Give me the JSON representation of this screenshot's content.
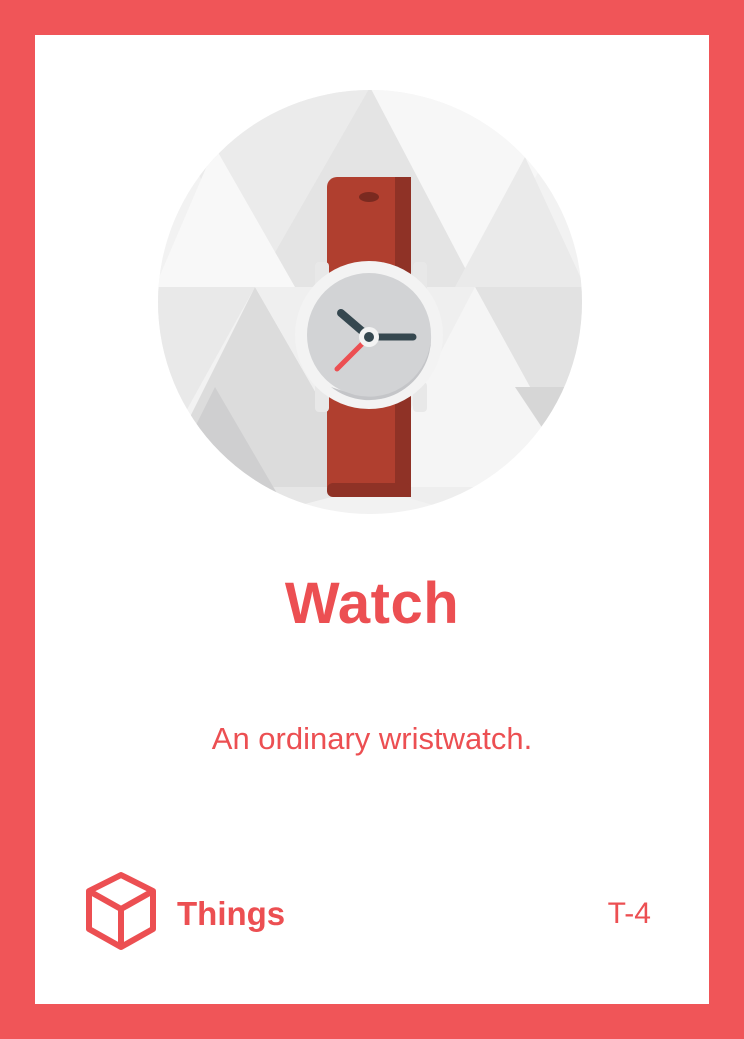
{
  "card": {
    "title": "Watch",
    "description": "An ordinary wristwatch.",
    "category": "Things",
    "code": "T-4"
  },
  "colors": {
    "frame": "#f05558",
    "accent": "#ec4f52",
    "strap": "#b03f2f",
    "strap_dark": "#8f3226",
    "case": "#f3f3f3",
    "dial": "#d2d3d5",
    "hands": "#35474f",
    "second_hand": "#ec4f52"
  },
  "icons": {
    "illustration": "wristwatch-icon",
    "category": "cube-icon"
  }
}
